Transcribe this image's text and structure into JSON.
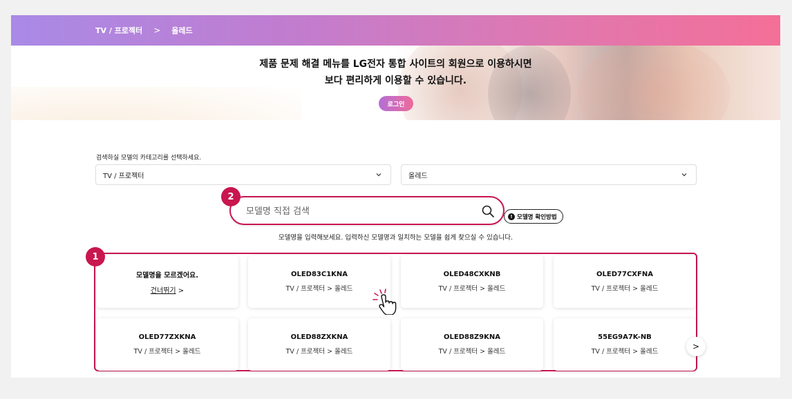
{
  "breadcrumb": {
    "items": [
      "TV / 프로젝터",
      "올레드"
    ],
    "separator": ">"
  },
  "banner": {
    "line1": "제품 문제 해결 메뉴를 LG전자 통합 사이트의 회원으로 이용하시면",
    "line2": "보다 편리하게 이용할 수 있습니다.",
    "login_label": "로그인"
  },
  "category": {
    "label": "검색하실 모델의 카테고리를 선택하세요.",
    "select1": "TV / 프로젝터",
    "select2": "올레드"
  },
  "search": {
    "placeholder": "모델명 직접 검색",
    "help_label": "모델명 확인방법",
    "helper_text": "모델명을 입력해보세요. 입력하신 모델명과 일치하는 모델을 쉽게 찾으실 수 있습니다."
  },
  "badges": [
    "1",
    "2"
  ],
  "unknown_card": {
    "title": "모델명을 모르겠어요.",
    "skip_label": "건너뛰기",
    "skip_arrow": ">"
  },
  "models": [
    {
      "name": "OLED83C1KNA",
      "path": "TV / 프로젝터 > 올레드"
    },
    {
      "name": "OLED48CXKNB",
      "path": "TV / 프로젝터 > 올레드"
    },
    {
      "name": "OLED77CXFNA",
      "path": "TV / 프로젝터 > 올레드"
    },
    {
      "name": "OLED77ZXKNA",
      "path": "TV / 프로젝터 > 올레드"
    },
    {
      "name": "OLED88ZXKNA",
      "path": "TV / 프로젝터 > 올레드"
    },
    {
      "name": "OLED88Z9KNA",
      "path": "TV / 프로젝터 > 올레드"
    },
    {
      "name": "55EG9A7K-NB",
      "path": "TV / 프로젝터 > 올레드"
    }
  ],
  "next_arrow": ">",
  "colors": {
    "accent": "#c9164f",
    "gradient_start": "#a98ae6",
    "gradient_end": "#f46f98"
  },
  "icons": [
    "search-icon",
    "chevron-down-icon",
    "info-icon",
    "chevron-right-icon",
    "hand-pointer-icon"
  ]
}
